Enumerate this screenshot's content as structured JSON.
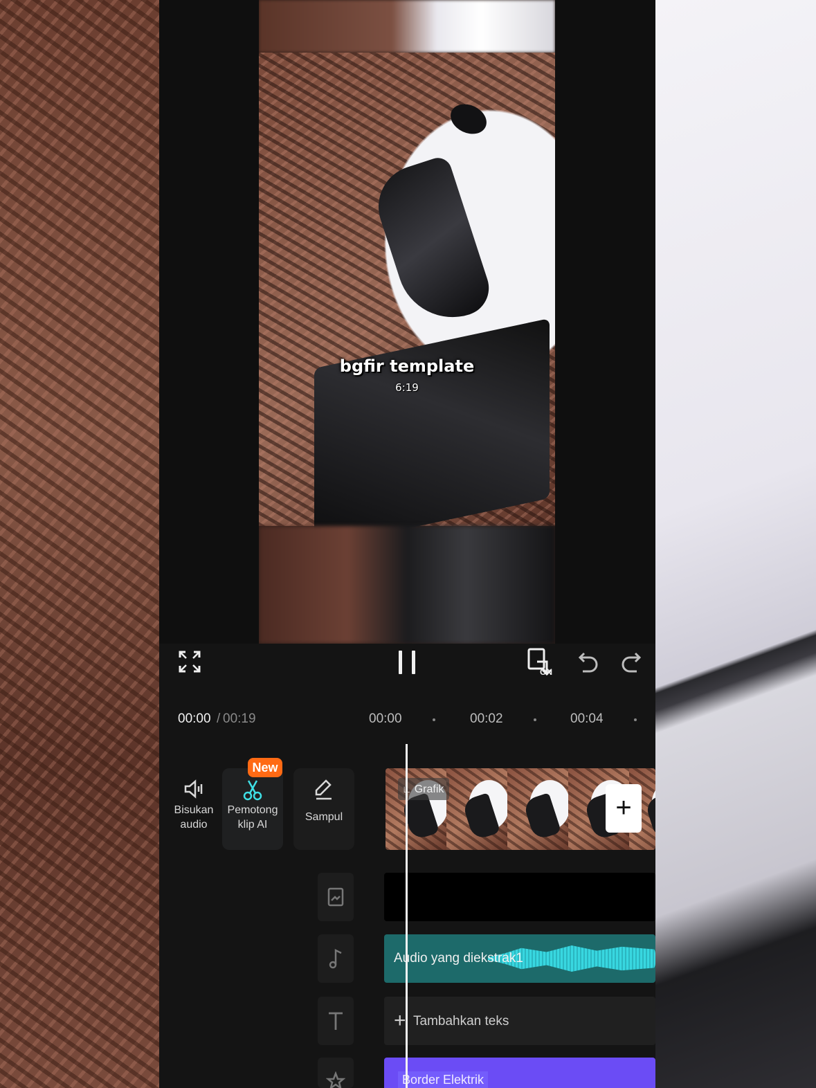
{
  "preview": {
    "overlay_title": "bgfir template",
    "overlay_subtitle": "6:19"
  },
  "controls": {
    "fullscreen_icon": "expand-icon",
    "pause_icon": "pause-icon",
    "ratio_label": "ON",
    "undo_icon": "undo-icon",
    "redo_icon": "redo-icon"
  },
  "timeline": {
    "current_time": "00:00",
    "separator": "/",
    "total_time": "00:19",
    "ticks": [
      "00:00",
      "00:02",
      "00:04"
    ]
  },
  "tools": {
    "mute_label_1": "Bisukan",
    "mute_label_2": "audio",
    "cut_label_1": "Pemotong",
    "cut_label_2": "klip AI",
    "new_badge": "New",
    "cover_label": "Sampul"
  },
  "tracks": {
    "clip_tag": "Grafik",
    "add_clip": "+",
    "audio_label": "Audio yang diekstrak1",
    "text_add_plus": "+",
    "text_add_label": "Tambahkan teks",
    "effect_label": "Border Elektrik"
  },
  "colors": {
    "accent_new": "#ff6a14",
    "audio_track": "#1d6a6a",
    "audio_wave": "#38d7e0",
    "effect_track": "#6b4cf5"
  }
}
